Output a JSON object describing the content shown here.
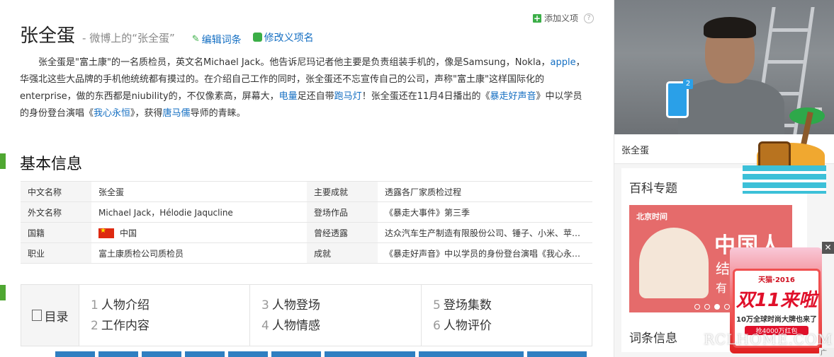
{
  "header": {
    "add_item": "添加义项",
    "help": "?",
    "title": "张全蛋",
    "subtitle": "- 微博上的“张全蛋”",
    "edit_link": "编辑词条",
    "modify_link": "修改义项名"
  },
  "summary": {
    "p1": "张全蛋是\"富土康\"的一名质检员，英文名Michael Jack。他告诉尼玛记者他主要是负责组装手机的，像是Samsung，Nokla，",
    "apple": "apple",
    "p2": "，华强北这些大品牌的手机他统统都有摸过的。在介绍自己工作的同时，张全蛋还不忘宣传自己的公司，声称\"富土康\"这样国际化的enterprise，做的东西都是niubility的，不仅像素高，屏幕大，",
    "dianliang": "电量",
    "p3": "足还自带",
    "paomadeng": "跑马灯",
    "p4": "！张全蛋还在11月4日播出的《",
    "show1": "暴走好声音",
    "p5": "》中以学员的身份登台演唱《",
    "song": "我心永恒",
    "p6": "》，获得",
    "mentor": "唐马儒",
    "p7": "导师的青睐。"
  },
  "basic_info": {
    "title": "基本信息",
    "rows": [
      {
        "k1": "中文名称",
        "v1": "张全蛋",
        "k2": "主要成就",
        "v2": "透露各厂家质检过程"
      },
      {
        "k1": "外文名称",
        "v1": "Michael Jack，Hélodie Jaqucline",
        "k2": "登场作品",
        "v2": "《暴走大事件》第三季"
      },
      {
        "k1": "国籍",
        "v1": "中国",
        "k2": "曾经透露",
        "v2": "达众汽车生产制造有限股份公司、锤子、小米、苹果..."
      },
      {
        "k1": "职业",
        "v1": "富土康质检公司质检员",
        "k2": "成就",
        "v2": "《暴走好声音》中以学员的身份登台演唱《我心永恒..."
      }
    ]
  },
  "toc": {
    "label": "目录",
    "items": [
      {
        "n": "1",
        "t": "人物介绍"
      },
      {
        "n": "2",
        "t": "工作内容"
      },
      {
        "n": "3",
        "t": "人物登场"
      },
      {
        "n": "4",
        "t": "人物情感"
      },
      {
        "n": "5",
        "t": "登场集数"
      },
      {
        "n": "6",
        "t": "人物评价"
      }
    ]
  },
  "sidebar": {
    "photo_caption": "张全蛋",
    "phone_badge": "2",
    "topic_title": "百科专题",
    "banner_logo": "北京时间",
    "banner_big": "中国人",
    "banner_line2": "结",
    "banner_line3": "有",
    "entry_info": "词条信息"
  },
  "ad": {
    "close": "✕",
    "brand": "天猫·2016",
    "big": "双11来啦",
    "line1": "10万全球时尚大牌也来了",
    "line2": "抢4000万红包",
    "tag": "广告"
  },
  "watermark": "RCLHOME.COM",
  "colors": {
    "accent_green": "#4fa732",
    "link_blue": "#136ec2"
  }
}
